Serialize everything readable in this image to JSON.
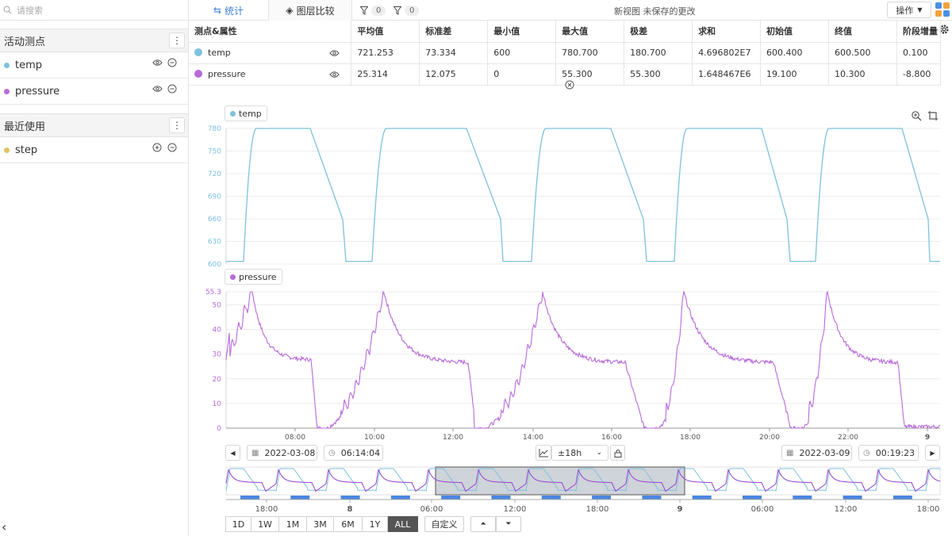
{
  "sidebar": {
    "search_placeholder": "请搜索",
    "active_section": "活动测点",
    "active_items": [
      {
        "label": "temp",
        "color": "#7ec1dd"
      },
      {
        "label": "pressure",
        "color": "#b86ad9"
      }
    ],
    "recent_section": "最近使用",
    "recent_items": [
      {
        "label": "step",
        "color": "#e3c15f"
      }
    ],
    "collapse_glyph": "‹"
  },
  "topbar": {
    "tab_stats": "统计",
    "tab_layers": "图层比较",
    "filter1_count": "0",
    "filter2_count": "0",
    "view_title": "新视图 未保存的更改",
    "actions_label": "操作"
  },
  "stats": {
    "headers": [
      "测点&属性",
      "平均值",
      "标准差",
      "最小值",
      "最大值",
      "极差",
      "求和",
      "初始值",
      "终值",
      "阶段增量"
    ],
    "rows": [
      {
        "name": "temp",
        "color": "#7ec1dd",
        "values": [
          "721.253",
          "73.334",
          "600",
          "780.700",
          "180.700",
          "4.696802E7",
          "600.400",
          "600.500",
          "0.100"
        ]
      },
      {
        "name": "pressure",
        "color": "#b86ad9",
        "values": [
          "25.314",
          "12.075",
          "0",
          "55.300",
          "55.300",
          "1.648467E6",
          "19.100",
          "10.300",
          "-8.800"
        ]
      }
    ]
  },
  "chart_data": [
    {
      "type": "line",
      "series": [
        {
          "name": "temp",
          "color": "#7ec1dd"
        }
      ],
      "yticks": [
        "780",
        "750",
        "720",
        "690",
        "660",
        "630",
        "600"
      ],
      "ylim": [
        600,
        780
      ],
      "grid": true
    },
    {
      "type": "line",
      "series": [
        {
          "name": "pressure",
          "color": "#b86ad9"
        }
      ],
      "yticks": [
        "55.3",
        "50",
        "40",
        "30",
        "20",
        "10",
        "0"
      ],
      "ylim": [
        0,
        55.3
      ],
      "xticks": [
        "08:00",
        "10:00",
        "12:00",
        "14:00",
        "16:00",
        "18:00",
        "20:00",
        "22:00",
        "9"
      ],
      "grid": true
    }
  ],
  "controls": {
    "start_date": "2022-03-08",
    "start_time": "06:14:04",
    "span": "±18h",
    "end_date": "2022-03-09",
    "end_time": "00:19:23"
  },
  "navigator": {
    "xticks": [
      "18:00",
      "8",
      "06:00",
      "12:00",
      "18:00",
      "9",
      "06:00",
      "12:00",
      "18:00"
    ]
  },
  "ranges": [
    "1D",
    "1W",
    "1M",
    "3M",
    "6M",
    "1Y",
    "ALL"
  ],
  "active_range": "ALL",
  "custom_label": "自定义"
}
